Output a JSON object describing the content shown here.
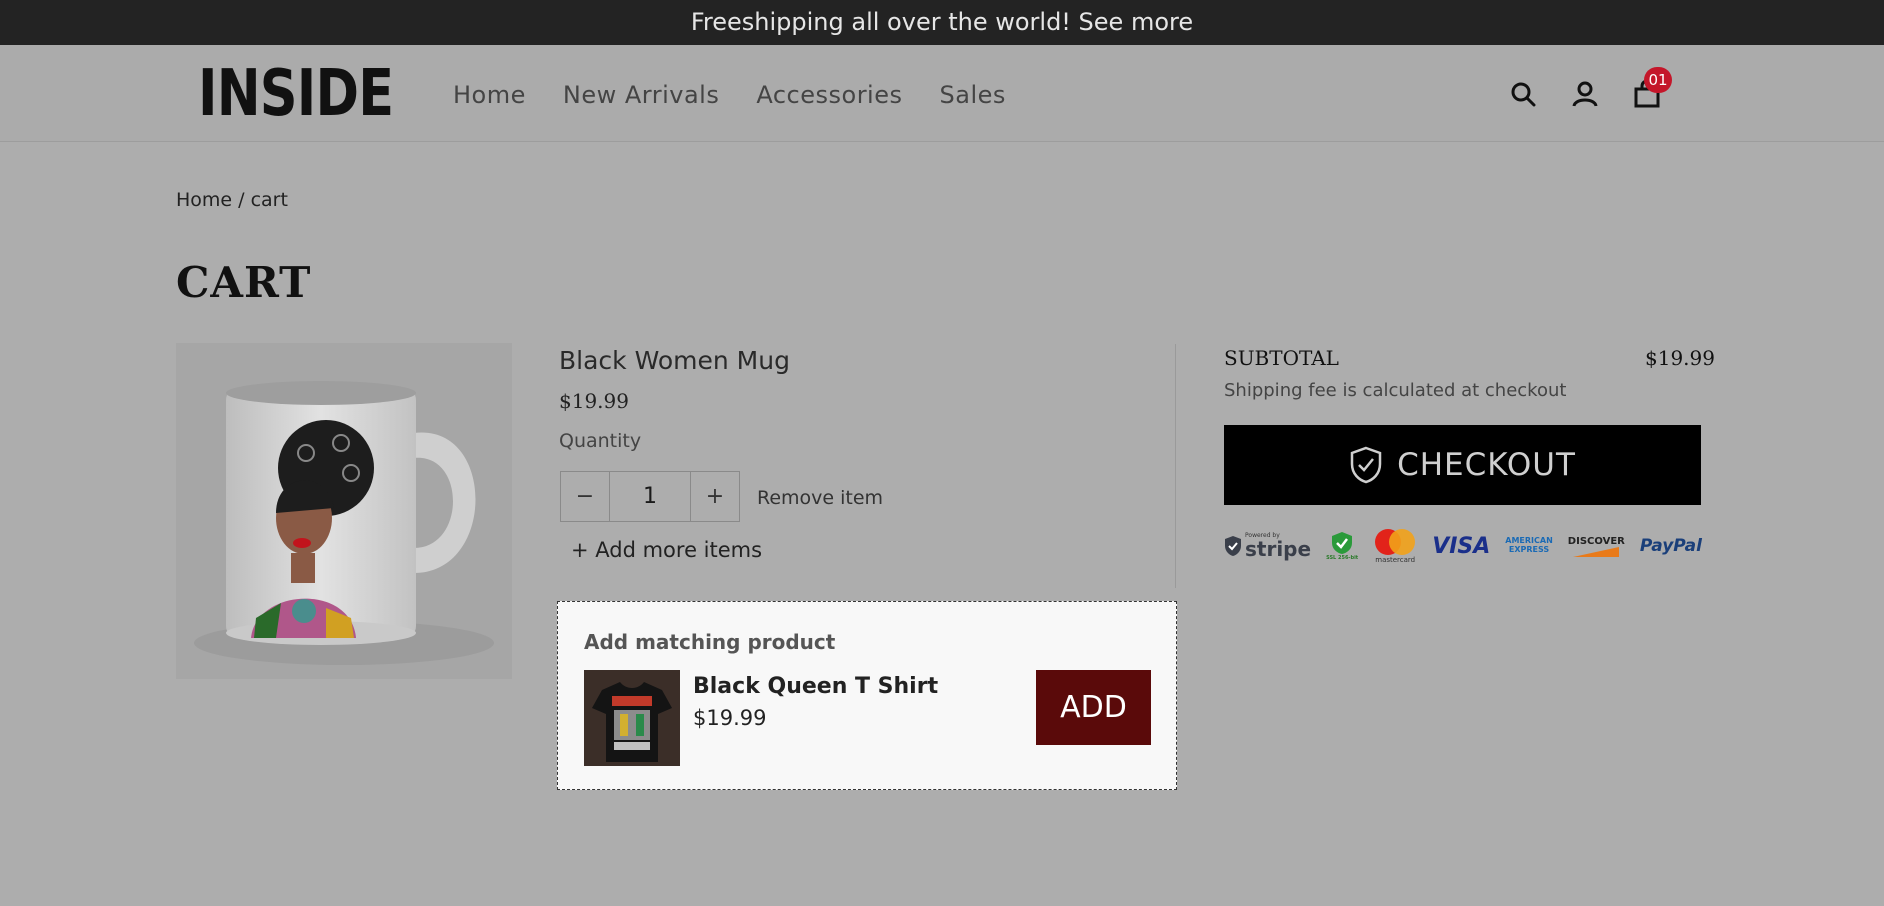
{
  "announcement": "Freeshipping all over the world! See more",
  "brand": "INSIDE",
  "nav": [
    "Home",
    "New Arrivals",
    "Accessories",
    "Sales"
  ],
  "cart_count": "01",
  "breadcrumb": {
    "home": "Home",
    "sep": " / ",
    "current": "cart"
  },
  "page_title": "CART",
  "item": {
    "name": "Black Women Mug",
    "price": "$19.99",
    "quantity_label": "Quantity",
    "quantity": "1",
    "minus": "−",
    "plus": "+",
    "remove": "Remove item",
    "add_more": "+ Add more items"
  },
  "matching": {
    "title": "Add matching product",
    "product_name": "Black Queen T Shirt",
    "product_price": "$19.99",
    "add_label": "ADD"
  },
  "summary": {
    "subtotal_label": "SUBTOTAL",
    "subtotal_value": "$19.99",
    "shipping_note": "Shipping fee is calculated at checkout",
    "checkout_label": "CHECKOUT"
  },
  "payments": {
    "stripe_small": "Powered by",
    "stripe": "stripe",
    "ssl": "SSL 256-bit",
    "mastercard": "mastercard",
    "visa": "VISA",
    "amex_line1": "AMERICAN",
    "amex_line2": "EXPRESS",
    "discover": "DISCOVER",
    "paypal": "PayPal"
  },
  "colors": {
    "accent_add": "#5a0a0a",
    "badge": "#c4162a",
    "checkout_bg": "#000000"
  },
  "icons": [
    "search-icon",
    "user-icon",
    "cart-icon",
    "shield-check-icon"
  ]
}
